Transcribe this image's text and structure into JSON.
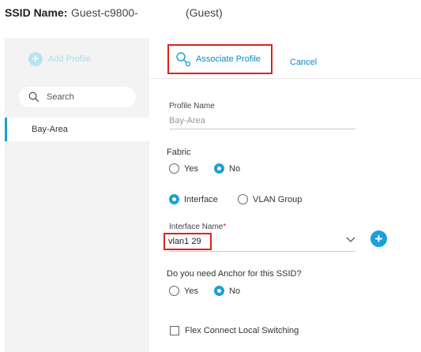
{
  "header": {
    "ssid_label": "SSID Name:",
    "ssid_value": "Guest-c9800-",
    "ssid_type": "(Guest)"
  },
  "sidebar": {
    "add_profile_label": "Add Profile",
    "search_placeholder": "Search",
    "items": [
      {
        "label": "Bay-Area",
        "selected": true
      }
    ]
  },
  "toolbar": {
    "associate_label": "Associate Profile",
    "cancel_label": "Cancel"
  },
  "form": {
    "profile_name_label": "Profile Name",
    "profile_name_value": "Bay-Area",
    "fabric_label": "Fabric",
    "fabric_options": [
      "Yes",
      "No"
    ],
    "fabric_selected": "No",
    "mode_options": [
      "Interface",
      "VLAN Group"
    ],
    "mode_selected": "Interface",
    "interface_name_label": "Interface Name",
    "interface_name_required": "*",
    "interface_name_value": "vlan1 29",
    "anchor_label": "Do you need Anchor for this SSID?",
    "anchor_options": [
      "Yes",
      "No"
    ],
    "anchor_selected": "No",
    "flex_label": "Flex Connect Local Switching",
    "flex_checked": false
  },
  "colors": {
    "accent": "#1ba0d7",
    "link": "#0b8ac9",
    "highlight_border": "#d9241c"
  },
  "icons": {
    "add_profile": "plus-circle-icon",
    "search": "search-icon",
    "associate": "magnifier-link-icon",
    "dropdown": "chevron-down-icon",
    "add_interface": "plus-circle-icon"
  }
}
